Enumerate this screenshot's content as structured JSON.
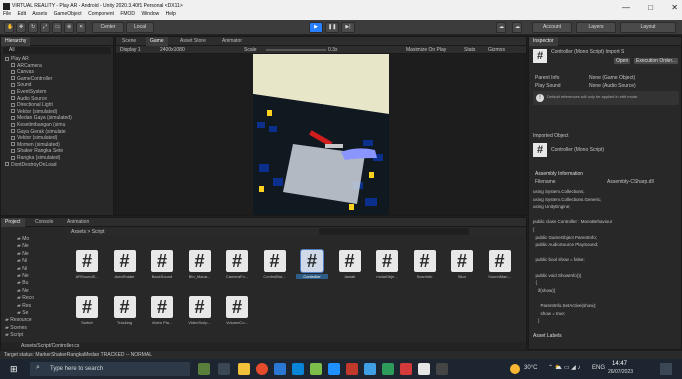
{
  "window": {
    "title": "VIRTUAL REALITY - Play AR - Android - Unity 2020.3.40f1 Personal <DX11>",
    "min": "—",
    "max": "□",
    "close": "✕"
  },
  "menu": [
    "File",
    "Edit",
    "Assets",
    "GameObject",
    "Component",
    "FMOD",
    "Window",
    "Help"
  ],
  "toolbar": {
    "center": "Center",
    "local": "Local",
    "account": "Account",
    "layers": "Layers",
    "layout": "Layout"
  },
  "hierarchy": {
    "title": "Hierarchy",
    "search": "All",
    "items": [
      {
        "text": "Play AR",
        "depth": 0
      },
      {
        "text": "ARCamera",
        "depth": 1
      },
      {
        "text": "Canvas",
        "depth": 1
      },
      {
        "text": "GameController",
        "depth": 1
      },
      {
        "text": "Sound",
        "depth": 1
      },
      {
        "text": "EventSystem",
        "depth": 1
      },
      {
        "text": "Audio Source",
        "depth": 1
      },
      {
        "text": "Directional Light",
        "depth": 1
      },
      {
        "text": "Vektor (simulated)",
        "depth": 1
      },
      {
        "text": "Medan Gaya (simulated)",
        "depth": 1
      },
      {
        "text": "Kesetimbangan (simu",
        "depth": 1
      },
      {
        "text": "Gaya Gerak (simulate",
        "depth": 1
      },
      {
        "text": "Vektor (simulated)",
        "depth": 1
      },
      {
        "text": "Momen (simulated)",
        "depth": 1
      },
      {
        "text": "Shaker Rangka Sete",
        "depth": 1
      },
      {
        "text": "Rangka (simulated)",
        "depth": 1
      },
      {
        "text": "DontDestroyOnLoad",
        "depth": 0
      }
    ]
  },
  "scene_tabs": [
    "Scene",
    "Game",
    "Asset Store",
    "Animator"
  ],
  "game_bar": {
    "display": "Display 1",
    "resolution": "2400x1080",
    "scale_label": "Scale",
    "scale": "0.3x",
    "maximize": "Maximize On Play",
    "stats": "Stats",
    "gizmos": "Gizmos"
  },
  "project": {
    "tabs": [
      "Project",
      "Console",
      "Animation"
    ],
    "breadcrumb": "Assets > Script",
    "folders": [
      "Mo",
      "Ne",
      "Ne",
      "Ni",
      "Ni",
      "Ne",
      "Bu",
      "Ne",
      "Reco",
      "Res",
      "Se",
      "Resource",
      "Scenes",
      "Script"
    ],
    "files": [
      "ARSoundS...",
      "AutoRotate",
      "BackSound",
      "Btn_Mana...",
      "CameraFo...",
      "ControlBut...",
      "Controller",
      "Jawab",
      "mulaiObje...",
      "ScanInfo",
      "Skor",
      "SoundMan...",
      "Switch",
      "Tracking",
      "Video Pla...",
      "VideoScrip...",
      "VolumeCo..."
    ],
    "selected": "Controller",
    "status_path": "Assets/Script/Controller.cs"
  },
  "inspector": {
    "title": "Inspector",
    "object_name": "Controller (Mono Script) Import S",
    "open_label": "Open",
    "exec_label": "Execution Order...",
    "parent_info_label": "Parent Info",
    "parent_info_value": "None (Game Object)",
    "play_sound_label": "Play Sound",
    "play_sound_value": "None (Audio Source)",
    "info_text": "Default references will only be applied in edit mode.",
    "imported_label": "Imported Object",
    "imported_name": "Controller (Mono Script)",
    "assembly_info": "Assembly Information",
    "filename_label": "Filename",
    "filename_value": "Assembly-CSharp.dll",
    "code": [
      "using System.Collections;",
      "using System.Collections.Generic;",
      "using UnityEngine;",
      "",
      "public class Controller : MonoBehaviour",
      "{",
      "  public GameObject ParentInfo;",
      "  public AudioSource PlaySound;",
      "",
      "  public bool show = false;",
      "",
      "  public void ShowInfo(){",
      "  {",
      "    if(show){",
      "",
      "      ParentInfo.SetActive(show);",
      "      show = true;",
      "    }"
    ],
    "asset_labels": "Asset Labels"
  },
  "status_bar": "Target status: MarkerShakerRangkaMedan TRACKED -- NORMAL",
  "taskbar": {
    "search": "Type here to search",
    "temp": "30°C",
    "time": "14:47",
    "date": "26/07/2023",
    "lang": "ENG"
  },
  "colors": {
    "play_active": "#2a7fff",
    "selection": "#2c5d87",
    "titlebar": "#f0f0f0",
    "taskbar": "#1c2530"
  }
}
